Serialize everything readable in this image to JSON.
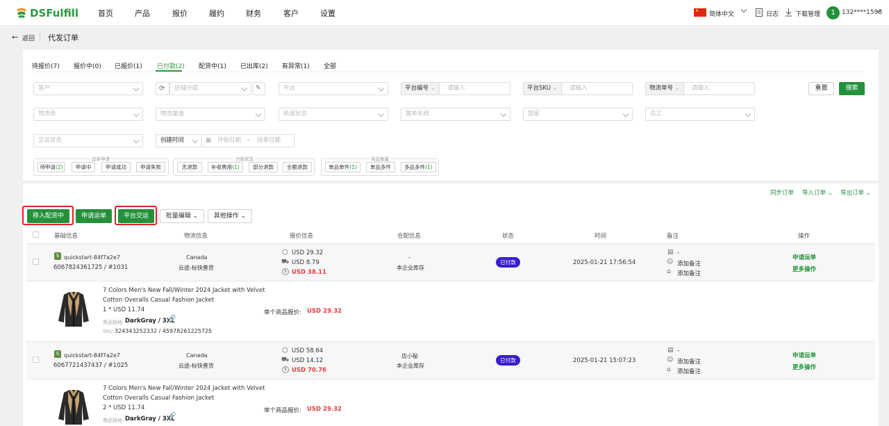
{
  "brand": {
    "name": "DSFulfill"
  },
  "nav": [
    "首页",
    "产品",
    "报价",
    "履约",
    "财务",
    "客户",
    "设置"
  ],
  "header_right": {
    "language": "简体中文",
    "log": "日志",
    "downloads": "下载管理",
    "avatar_initial": "1",
    "user": "132****1598"
  },
  "breadcrumb": {
    "back": "返回",
    "title": "代发订单"
  },
  "tabs": [
    "待报价(7)",
    "报价中(0)",
    "已报价(1)",
    "已付款(2)",
    "配货中(1)",
    "已出库(2)",
    "有异常(1)",
    "全部"
  ],
  "active_tab": 3,
  "filters": {
    "customer": "客户",
    "shop_group": "店铺分组",
    "platform": "平台",
    "platform_no_label": "平台编号",
    "platform_sku_label": "平台SKU",
    "logistics_no_label": "物流单号",
    "input_placeholder": "请输入",
    "logistics_provider": "物流商",
    "logistics_channel": "物流渠道",
    "track_status": "轨道状态",
    "system": "属单系统",
    "country": "国家",
    "staff": "员工",
    "deliver_status": "交运状态",
    "created_time": "创建时间",
    "start_date": "开始日期",
    "date_sep": "-",
    "end_date": "结束日期",
    "reset": "重置",
    "search": "搜索"
  },
  "groups": {
    "waybill": {
      "title": "运单申请",
      "chips": [
        {
          "label": "待申请",
          "count": "(2)"
        },
        {
          "label": "申请中",
          "count": ""
        },
        {
          "label": "申请成功",
          "count": ""
        },
        {
          "label": "申请失败",
          "count": ""
        }
      ]
    },
    "payment": {
      "title": "付款状态",
      "chips": [
        {
          "label": "无退款",
          "count": ""
        },
        {
          "label": "补收费用",
          "count": "(1)"
        },
        {
          "label": "部分退款",
          "count": ""
        },
        {
          "label": "全额退款",
          "count": ""
        }
      ]
    },
    "qty": {
      "title": "商品数量",
      "chips": [
        {
          "label": "单品单件",
          "count": "(1)"
        },
        {
          "label": "单品多件",
          "count": ""
        },
        {
          "label": "多品多件",
          "count": "(1)"
        }
      ]
    }
  },
  "toolbar_links": {
    "sync": "同步订单",
    "import": "导入订单",
    "export": "导出订单"
  },
  "actions": {
    "move_to_picking": "移入配货中",
    "apply_waybill": "申请运单",
    "platform_deliver": "平台交运",
    "batch_edit": "批量编辑",
    "other": "其他操作"
  },
  "columns": [
    "基础信息",
    "物流信息",
    "报价信息",
    "仓配信息",
    "状态",
    "时间",
    "备注",
    "操作"
  ],
  "orders": [
    {
      "shop": "quickstart-84f7a2e7",
      "order_no": "6067824361725 / #1031",
      "country": "Canada",
      "channel": "云途-标快普货",
      "price_goods": "USD 29.32",
      "price_ship": "USD 8.79",
      "price_total": "USD 38.11",
      "wh1": "-",
      "wh2": "本企业库存",
      "status": "已付款",
      "time": "2025-01-21 17:56:54",
      "note1": "-",
      "note2": "添加备注",
      "note3": "添加备注",
      "op1": "申请运单",
      "op2": "更多操作",
      "product_title1": "7 Colors Men's New Fall/Winter 2024 Jacket with Velvet",
      "product_title2": "Cotton Overalls Casual Fashion Jacket",
      "qty_price": "1 * USD 11.74",
      "spec_label": "商品规格:",
      "spec": "DarkGray / 3XL",
      "sku_label": "SKU:",
      "sku": "324343252332 / 45978261225725",
      "unit_label": "单个商品报价:",
      "unit_price": "USD 29.32"
    },
    {
      "shop": "quickstart-84f7a2e7",
      "order_no": "6067721437437 / #1025",
      "country": "Canada",
      "channel": "云途-标快普货",
      "price_goods": "USD 58.64",
      "price_ship": "USD 14.12",
      "price_total": "USD 70.76",
      "wh1": "店小秘",
      "wh2": "本企业库存",
      "status": "已付款",
      "time": "2025-01-21 15:07:23",
      "note1": "-",
      "note2": "添加备注",
      "note3": "添加备注",
      "op1": "申请运单",
      "op2": "更多操作",
      "product_title1": "7 Colors Men's New Fall/Winter 2024 Jacket with Velvet",
      "product_title2": "Cotton Overalls Casual Fashion Jacket",
      "qty_price": "2 * USD 11.74",
      "spec_label": "商品规格:",
      "spec": "DarkGray / 3XL",
      "unit_label": "单个商品报价:",
      "unit_price": "USD 29.32"
    }
  ],
  "colors": {
    "primary": "#24913a",
    "highlight": "#e02020",
    "badge": "#3b1ccf",
    "price_red": "#e04040"
  }
}
